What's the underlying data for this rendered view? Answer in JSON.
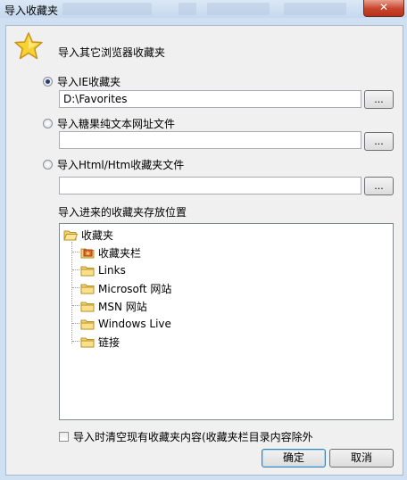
{
  "window": {
    "title": "导入收藏夹",
    "close_symbol": "✕"
  },
  "header": {
    "text": "导入其它浏览器收藏夹",
    "icon": "star-icon"
  },
  "options": [
    {
      "label": "导入IE收藏夹",
      "value": "D:\\Favorites",
      "selected": true
    },
    {
      "label": "导入糖果纯文本网址文件",
      "value": "",
      "selected": false
    },
    {
      "label": "导入Html/Htm收藏夹文件",
      "value": "",
      "selected": false
    }
  ],
  "browse_label": "...",
  "location_label": "导入进来的收藏夹存放位置",
  "tree": {
    "root": "收藏夹",
    "children": [
      "收藏夹栏",
      "Links",
      "Microsoft 网站",
      "MSN 网站",
      "Windows Live",
      "链接"
    ]
  },
  "clear_checkbox": {
    "label": "导入时清空现有收藏夹内容(收藏夹栏目录内容除外",
    "checked": false
  },
  "buttons": {
    "ok": "确定",
    "cancel": "取消"
  },
  "colors": {
    "folder": "#f5d36e",
    "selected_radio": "#1f3f7a",
    "close_button": "#c7432a"
  }
}
